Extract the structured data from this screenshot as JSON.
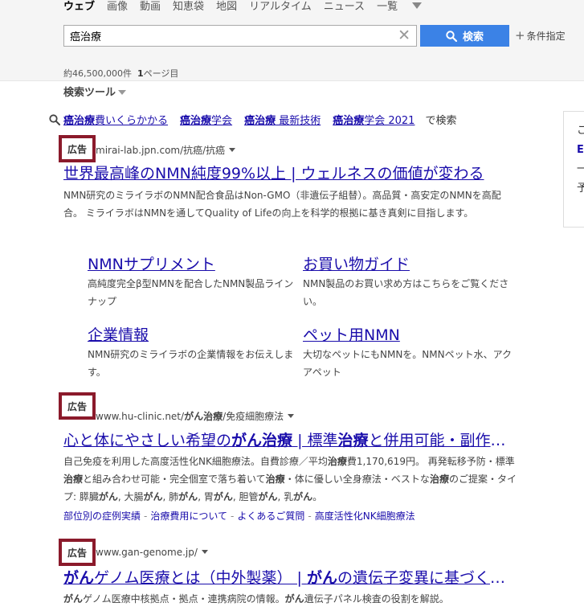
{
  "tabs": [
    {
      "label": "ウェブ",
      "active": true
    },
    {
      "label": "画像"
    },
    {
      "label": "動画"
    },
    {
      "label": "知恵袋"
    },
    {
      "label": "地図"
    },
    {
      "label": "リアルタイム"
    },
    {
      "label": "ニュース"
    },
    {
      "label": "一覧"
    }
  ],
  "search": {
    "query": "癌治療",
    "button": "検索",
    "conditions": "条件指定"
  },
  "result_count": {
    "count": "約46,500,000件",
    "page": "1",
    "page_suffix": "ページ目"
  },
  "tools_label": "検索ツール",
  "related": {
    "items": [
      {
        "bold": "癌治療",
        "rest": "費いくらかかる"
      },
      {
        "bold": "癌治療",
        "rest": "学会"
      },
      {
        "bold": "癌治療",
        "rest": " 最新技術"
      },
      {
        "bold": "癌治療",
        "rest": "学会 2021"
      }
    ],
    "suffix": "で検索"
  },
  "sidecard": {
    "lines": [
      "こ",
      "E",
      "一",
      "予"
    ]
  },
  "ads": [
    {
      "badge": "広告",
      "url": "mirai-lab.jpn.com/抗癌/抗癌",
      "title": "世界最高峰のNMN純度99%以上 | ウェルネスの価値が変わる",
      "desc": "NMN研究のミライラボのNMN配合食品はNon-GMO（非遺伝子組替）。高品質・高安定のNMNを高配合。 ミライラボはNMNを通してQuality of Lifeの向上を科学的根拠に基き真剣に目指します。",
      "sitelinks": [
        {
          "title": "NMNサプリメント",
          "desc": "高純度完全β型NMNを配合したNMN製品ラインナップ"
        },
        {
          "title": "お買い物ガイド",
          "desc": "NMN製品のお買い求め方はこちらをご覧ください。"
        },
        {
          "title": "企業情報",
          "desc": "NMN研究のミライラボの企業情報をお伝えします。"
        },
        {
          "title": "ペット用NMN",
          "desc": "大切なペットにもNMNを。NMNペット水、アクアペット"
        }
      ]
    },
    {
      "badge": "広告",
      "url_pre": "www.hu-clinic.net/",
      "url_bold": "がん治療",
      "url_post": "/免疫細胞療法",
      "title_parts": [
        {
          "t": "心と体にやさしい希望の"
        },
        {
          "t": "がん治療",
          "b": true
        },
        {
          "t": " | 標準"
        },
        {
          "t": "治療",
          "b": true
        },
        {
          "t": "と併用可能・副作用が少ない"
        }
      ],
      "desc_parts": [
        {
          "t": "自己免疫を利用した高度活性化NK細胞療法。自費診療／平均"
        },
        {
          "t": "治療",
          "b": true
        },
        {
          "t": "費1,170,619円。 再発転移予防・標準"
        },
        {
          "t": "治療",
          "b": true
        },
        {
          "t": "と組み合わせ可能・完全個室で落ち着いて"
        },
        {
          "t": "治療",
          "b": true
        },
        {
          "t": "・体に優しい全身療法・ベストな"
        },
        {
          "t": "治療",
          "b": true
        },
        {
          "t": "のご提案・タイプ: 膵臓"
        },
        {
          "t": "がん",
          "b": true
        },
        {
          "t": ", 大腸"
        },
        {
          "t": "がん",
          "b": true
        },
        {
          "t": ", 肺"
        },
        {
          "t": "がん",
          "b": true
        },
        {
          "t": ", 胃"
        },
        {
          "t": "がん",
          "b": true
        },
        {
          "t": ", 胆管"
        },
        {
          "t": "がん",
          "b": true
        },
        {
          "t": ", 乳"
        },
        {
          "t": "がん",
          "b": true
        },
        {
          "t": "。"
        }
      ],
      "links": [
        "部位別の症例実績",
        "治療費用について",
        "よくあるご質問",
        "高度活性化NK細胞療法"
      ]
    },
    {
      "badge": "広告",
      "url": "www.gan-genome.jp/",
      "title_parts": [
        {
          "t": "がん",
          "b": true
        },
        {
          "t": "ゲノム医療とは（中外製薬） | "
        },
        {
          "t": "がん",
          "b": true
        },
        {
          "t": "の遺伝子変異に基づく治療"
        }
      ],
      "desc_parts": [
        {
          "t": "がん",
          "b": true
        },
        {
          "t": "ゲノム医療中核拠点・拠点・連携病院の情報。"
        },
        {
          "t": "がん",
          "b": true
        },
        {
          "t": "遺伝子パネル検査の役割を解説。"
        }
      ]
    }
  ],
  "colors": {
    "link": "#1a0dab",
    "ad_frame": "#8b1a2b",
    "button": "#3b82e6",
    "topbar": "#f5f5f5"
  }
}
